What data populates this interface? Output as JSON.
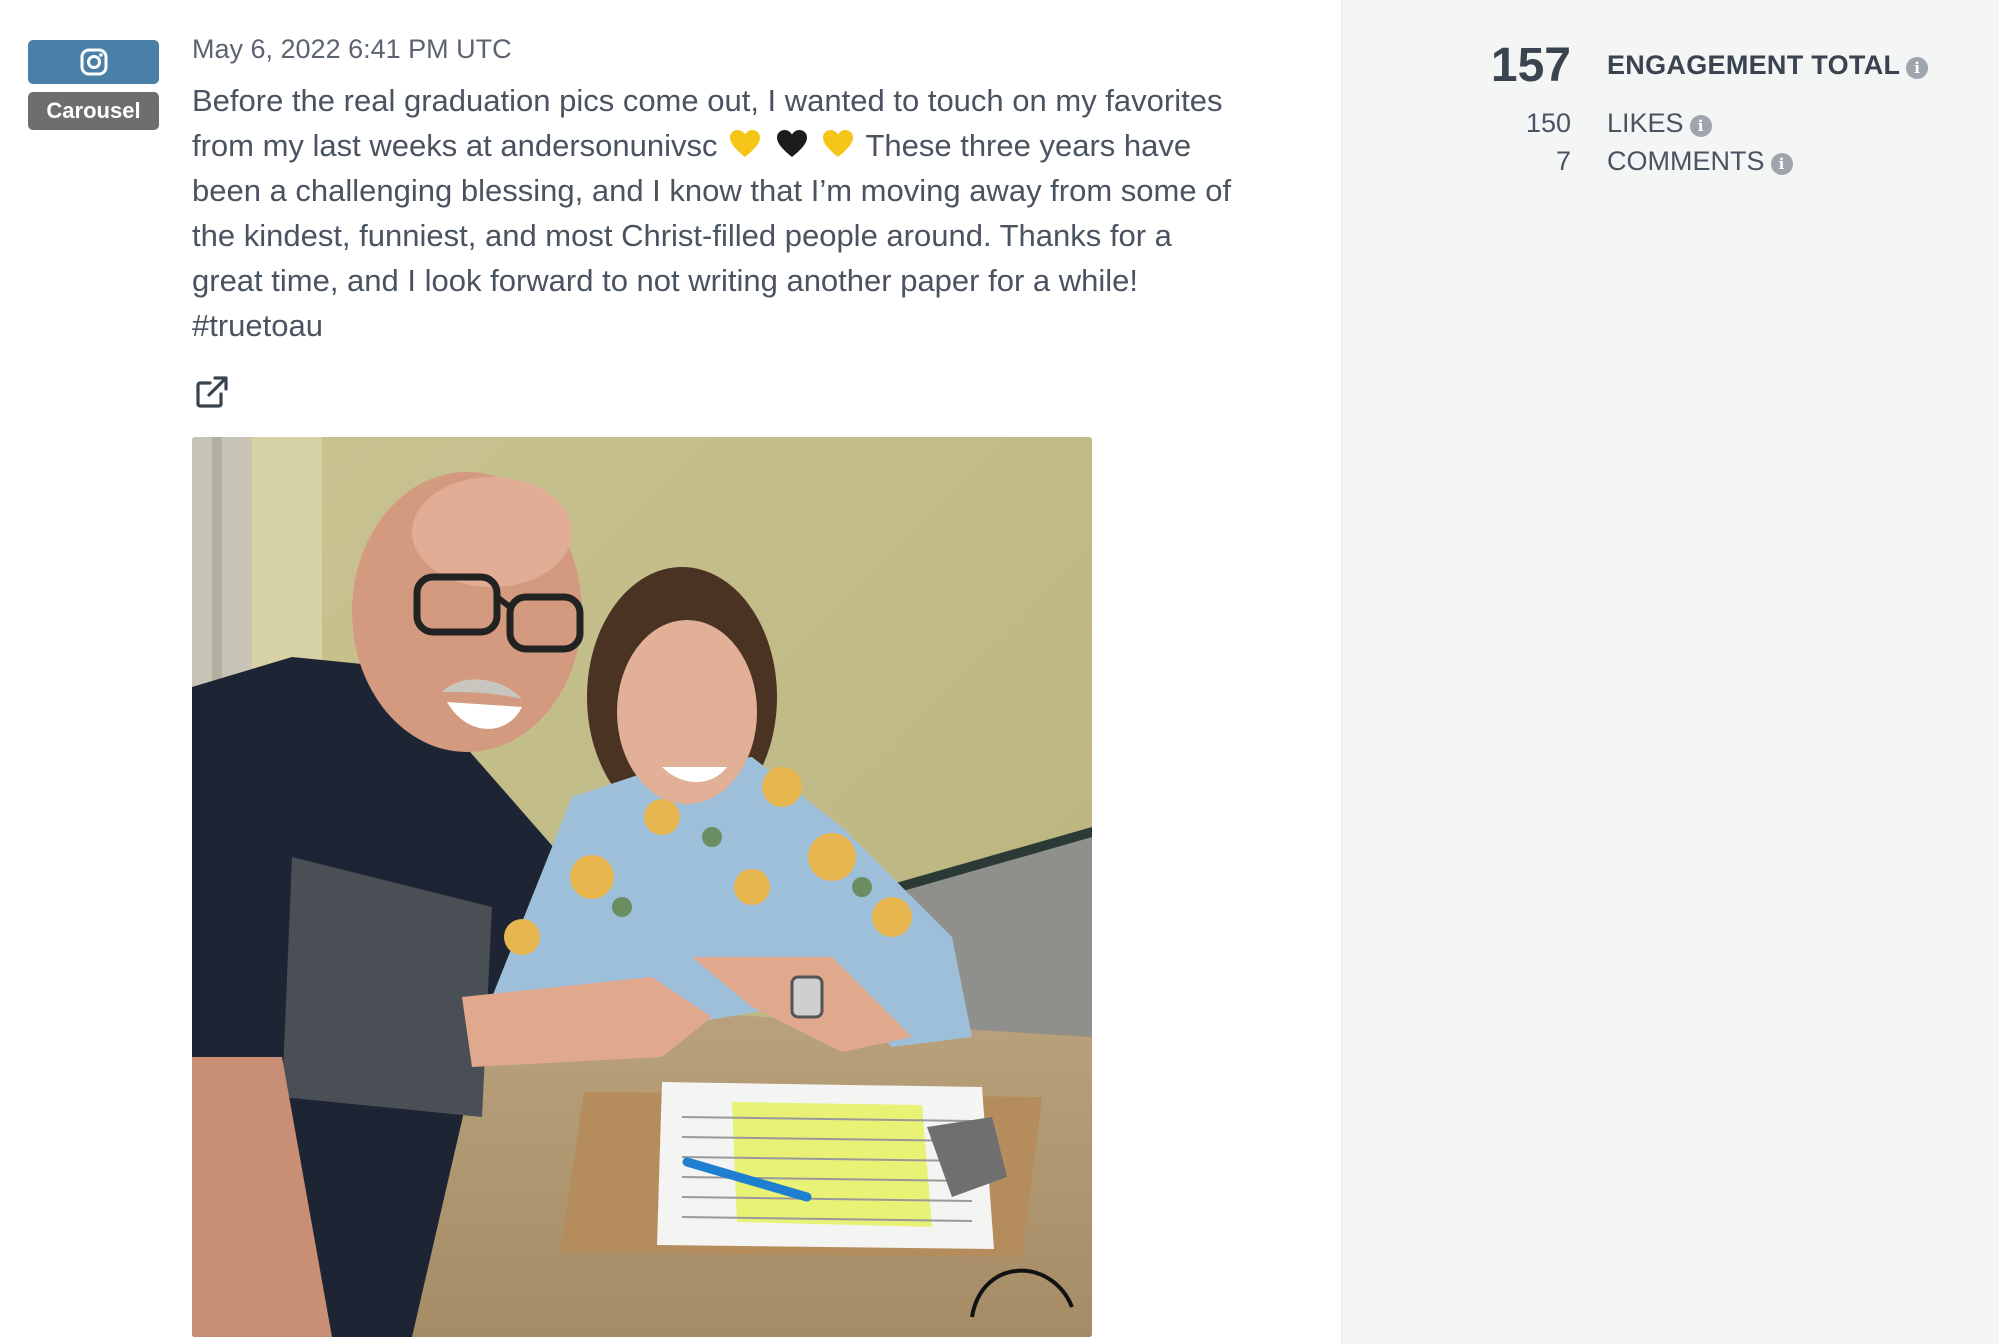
{
  "post": {
    "network_icon": "instagram-icon",
    "type_badge": "Carousel",
    "date": "May 6, 2022 6:41 PM UTC",
    "caption": {
      "line1": "Before the real graduation pics come out, I wanted to touch on my favorites",
      "line2_text": "from my last weeks at andersonunivsc",
      "line2_end": "These three years have",
      "line3": "been a challenging blessing, and I know that I’m moving away from some of",
      "line4": "the kindest, funniest, and most Christ-filled people around. Thanks for a",
      "line5": "great time, and I look forward to not writing another paper for a while!",
      "line6": "#truetoau"
    },
    "heart_colors": [
      "#f5c518",
      "#1c1c1c",
      "#f5c518"
    ],
    "external_link_icon": "external-link-icon",
    "photo_description_icon": "post-photo"
  },
  "metrics": {
    "engagement_total": "157",
    "engagement_label": "ENGAGEMENT TOTAL",
    "likes_value": "150",
    "likes_label": "LIKES",
    "comments_value": "7",
    "comments_label": "COMMENTS",
    "info_icon": "info-icon"
  },
  "colors": {
    "instagram_badge": "#4a7fa8",
    "type_badge": "#6e6e6e",
    "sidebar_bg": "#f4f5f5"
  }
}
